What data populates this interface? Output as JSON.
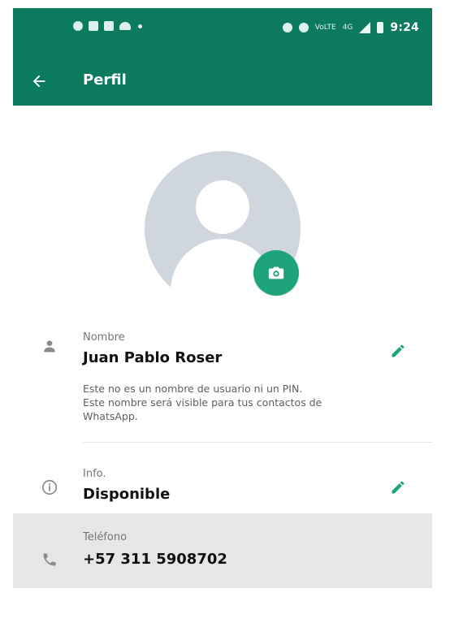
{
  "status_bar": {
    "network": "4G",
    "network_small": "VoLTE",
    "time": "9:24"
  },
  "app_bar": {
    "title": "Perfil"
  },
  "profile": {
    "name_section": {
      "label": "Nombre",
      "value": "Juan Pablo Roser",
      "description": "Este no es un nombre de usuario ni un PIN.\nEste nombre será visible para tus contactos de\nWhatsApp."
    },
    "info_section": {
      "label": "Info.",
      "value": "Disponible"
    },
    "phone_section": {
      "label": "Teléfono",
      "value": "+57 311 5908702"
    }
  },
  "colors": {
    "header": "#0b7a5f",
    "accent": "#1ea47a",
    "avatar_bg": "#cfd6dd",
    "phone_row_bg": "#e6e6e6"
  },
  "icons": {
    "back": "arrow-left-icon",
    "camera": "camera-icon",
    "person": "person-icon",
    "edit": "pencil-icon",
    "info": "info-icon",
    "phone": "phone-icon"
  }
}
